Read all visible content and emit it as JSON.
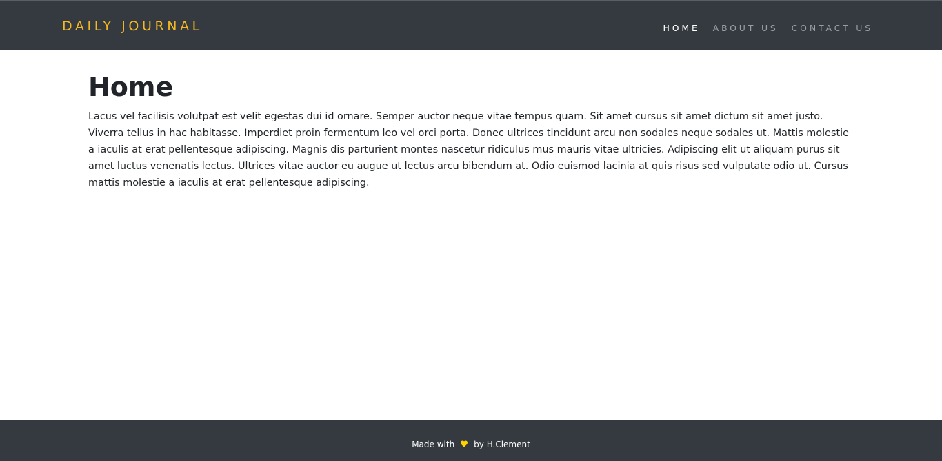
{
  "header": {
    "brand": "DAILY JOURNAL",
    "nav": [
      {
        "label": "HOME",
        "active": true
      },
      {
        "label": "ABOUT US",
        "active": false
      },
      {
        "label": "CONTACT US",
        "active": false
      }
    ]
  },
  "main": {
    "title": "Home",
    "paragraph": "Lacus vel facilisis volutpat est velit egestas dui id ornare. Semper auctor neque vitae tempus quam. Sit amet cursus sit amet dictum sit amet justo. Viverra tellus in hac habitasse. Imperdiet proin fermentum leo vel orci porta. Donec ultrices tincidunt arcu non sodales neque sodales ut. Mattis molestie a iaculis at erat pellentesque adipiscing. Magnis dis parturient montes nascetur ridiculus mus mauris vitae ultricies. Adipiscing elit ut aliquam purus sit amet luctus venenatis lectus. Ultrices vitae auctor eu augue ut lectus arcu bibendum at. Odio euismod lacinia at quis risus sed vulputate odio ut. Cursus mattis molestie a iaculis at erat pellentesque adipiscing."
  },
  "footer": {
    "made_with": "Made with",
    "heart_icon": "heart-icon",
    "by": "by H.Clement"
  },
  "colors": {
    "navbar_bg": "#343a40",
    "brand": "#f5b820",
    "nav_active": "#ffffff",
    "nav_inactive": "#9a9da1",
    "heart": "#ffd400"
  }
}
